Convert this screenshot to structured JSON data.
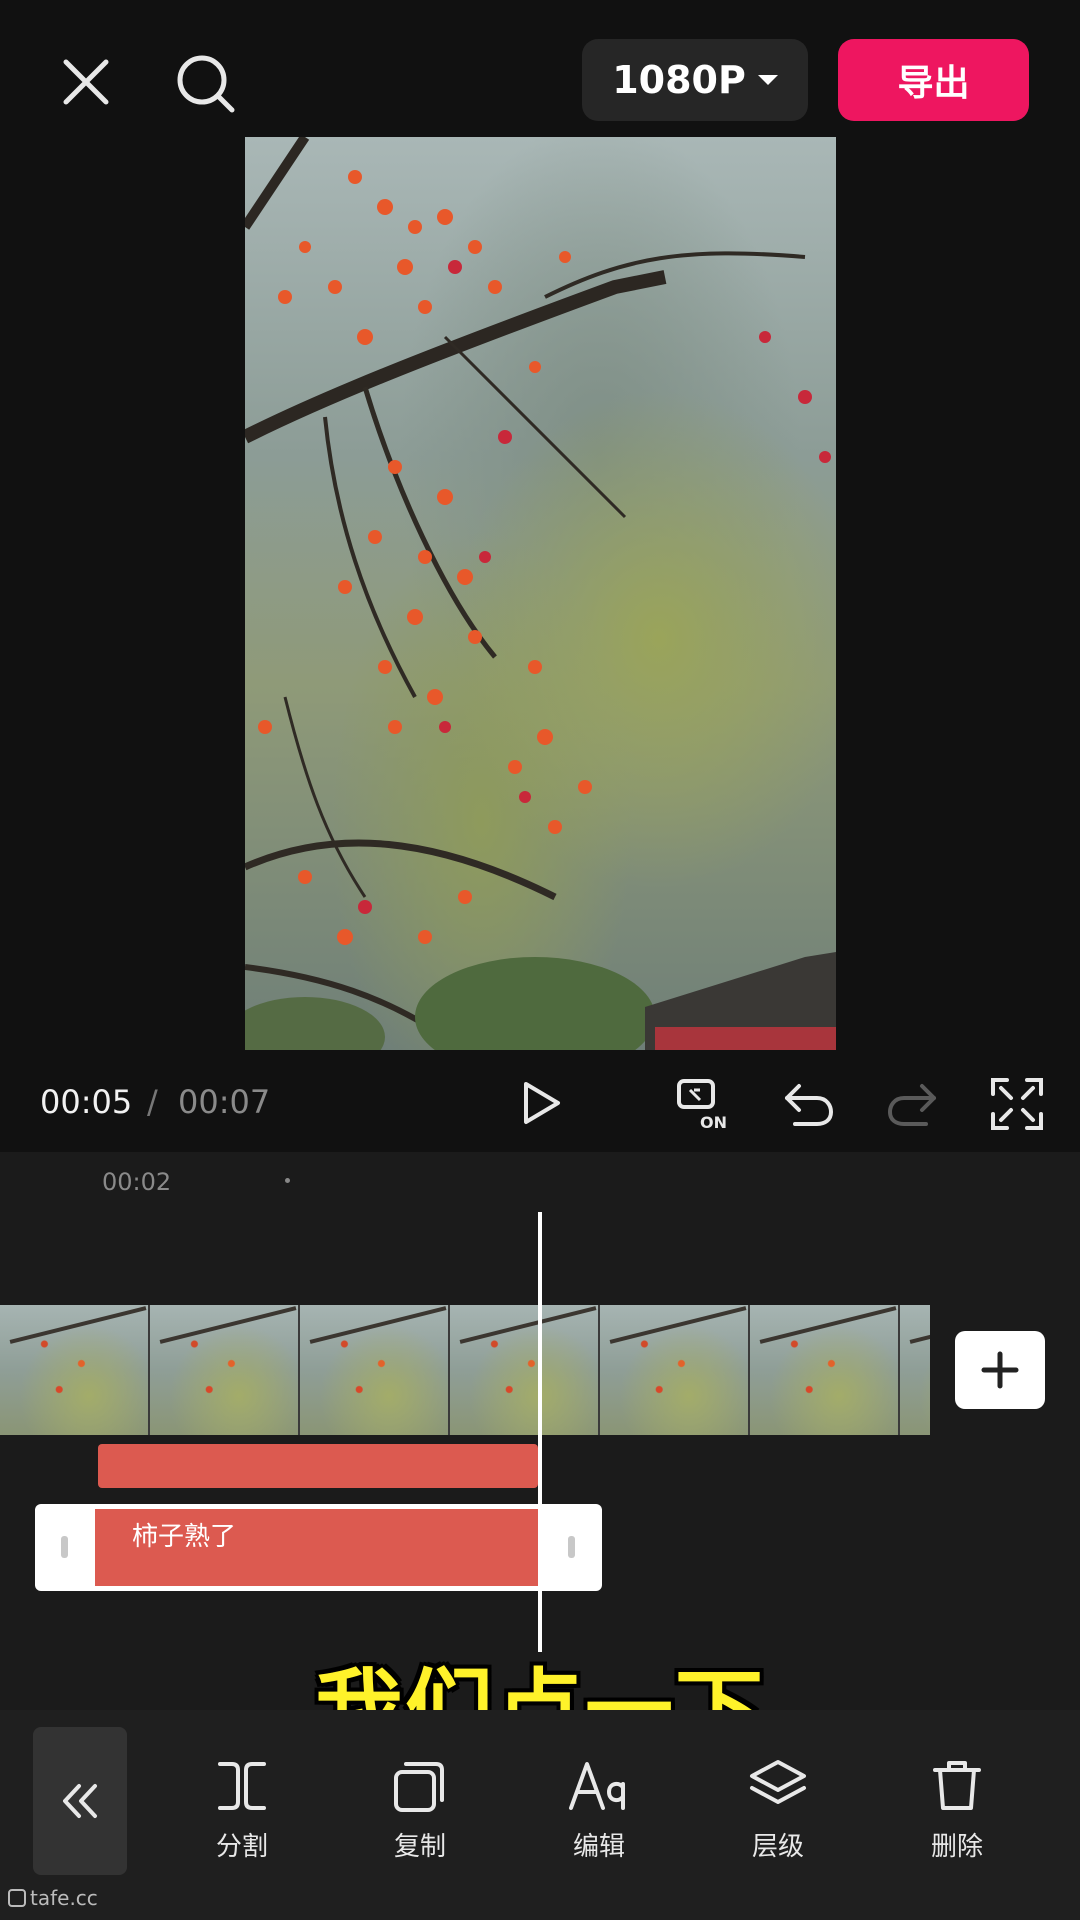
{
  "topbar": {
    "resolution": "1080P",
    "export_label": "导出"
  },
  "transport": {
    "current_time": "00:05",
    "separator": "/",
    "total_time": "00:07"
  },
  "timeline": {
    "ruler_label": "00:02",
    "text_clip_label": "柿子熟了"
  },
  "subtitle": "我们点一下",
  "toolbar": {
    "items": [
      {
        "label": "分割",
        "icon": "split-icon"
      },
      {
        "label": "复制",
        "icon": "copy-icon"
      },
      {
        "label": "编辑",
        "icon": "text-edit-icon"
      },
      {
        "label": "层级",
        "icon": "layers-icon"
      },
      {
        "label": "删除",
        "icon": "trash-icon"
      }
    ]
  },
  "watermark": "tafe.cc",
  "colors": {
    "export_accent": "#ee1660",
    "clip_color": "#dc5a50",
    "subtitle_color": "#fff22a"
  }
}
